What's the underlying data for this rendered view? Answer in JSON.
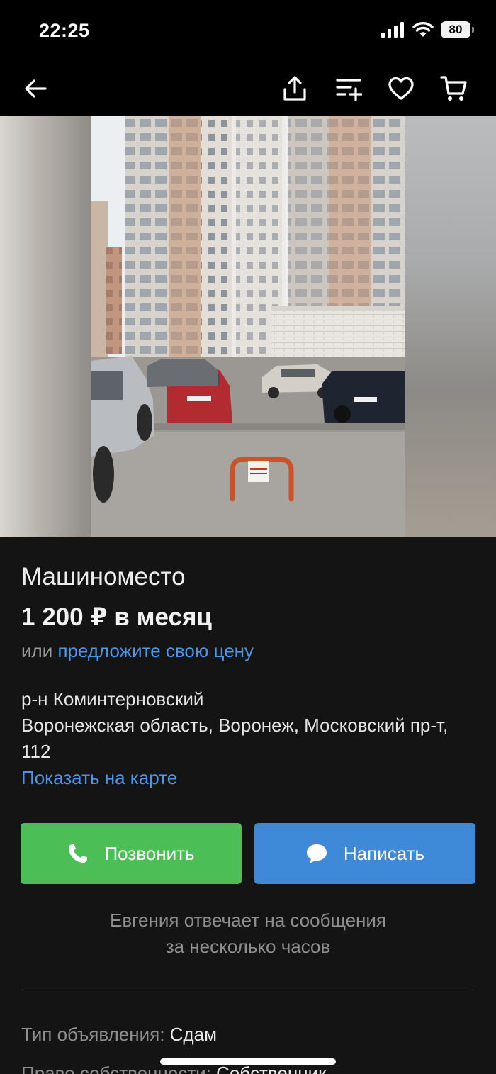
{
  "status_bar": {
    "time": "22:25",
    "battery": "80"
  },
  "nav": {
    "back_icon": "arrow-left-icon",
    "share_icon": "share-icon",
    "compare_icon": "compare-list-icon",
    "favorite_icon": "heart-icon",
    "cart_icon": "cart-icon"
  },
  "gallery": {
    "photo": "parking-space-photo"
  },
  "listing": {
    "title": "Машиноместо",
    "price": "1 200 ₽ в месяц",
    "offer_prefix": "или",
    "offer_link": "предложите свою цену",
    "district": "р-н Коминтерновский",
    "address": "Воронежская область, Воронеж, Московский пр-т, 112",
    "map_link": "Показать на карте"
  },
  "actions": {
    "call_label": "Позвонить",
    "write_label": "Написать"
  },
  "seller_note": {
    "line1": "Евгения отвечает на сообщения",
    "line2": "за несколько часов"
  },
  "params": [
    {
      "key": "Тип объявления:",
      "value": "Сдам"
    },
    {
      "key": "Право собственности:",
      "value": "Собственник"
    }
  ],
  "colors": {
    "accent_blue": "#4a96e8",
    "call_green": "#4bbf55",
    "write_blue": "#3f8ad8",
    "background": "#141414"
  }
}
